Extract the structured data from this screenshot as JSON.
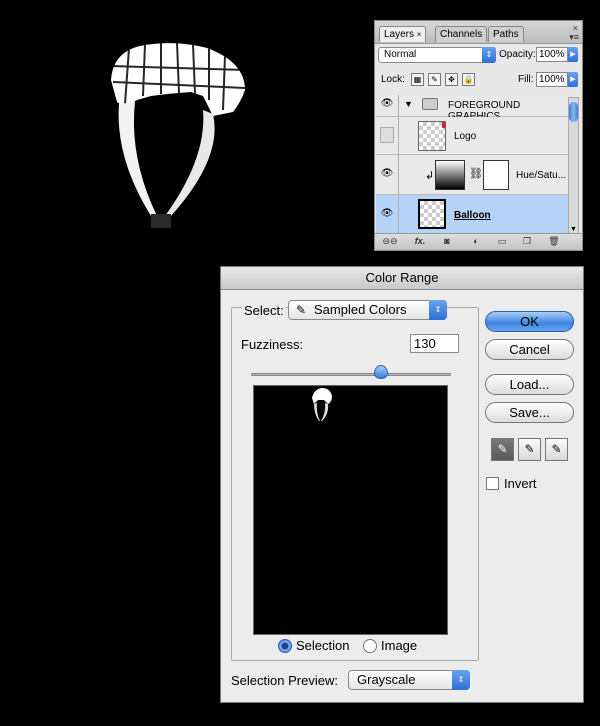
{
  "layers_panel": {
    "tabs": [
      "Layers",
      "Channels",
      "Paths"
    ],
    "close_glyph": "×",
    "blend_mode": "Normal",
    "opacity_label": "Opacity:",
    "opacity_value": "100%",
    "lock_label": "Lock:",
    "fill_label": "Fill:",
    "fill_value": "100%",
    "group_name": "FOREGROUND GRAPHICS",
    "layers": [
      "Logo",
      "Hue/Satu...",
      "Balloon"
    ],
    "bottom_fx": "fx."
  },
  "color_range": {
    "title": "Color Range",
    "select_label": "Select:",
    "select_value": "Sampled Colors",
    "fuzziness_label": "Fuzziness:",
    "fuzziness_value": "130",
    "radio_selection": "Selection",
    "radio_image": "Image",
    "preview_label": "Selection Preview:",
    "preview_value": "Grayscale",
    "buttons": {
      "ok": "OK",
      "cancel": "Cancel",
      "load": "Load...",
      "save": "Save..."
    },
    "invert_label": "Invert",
    "slider_fraction": 0.65
  }
}
